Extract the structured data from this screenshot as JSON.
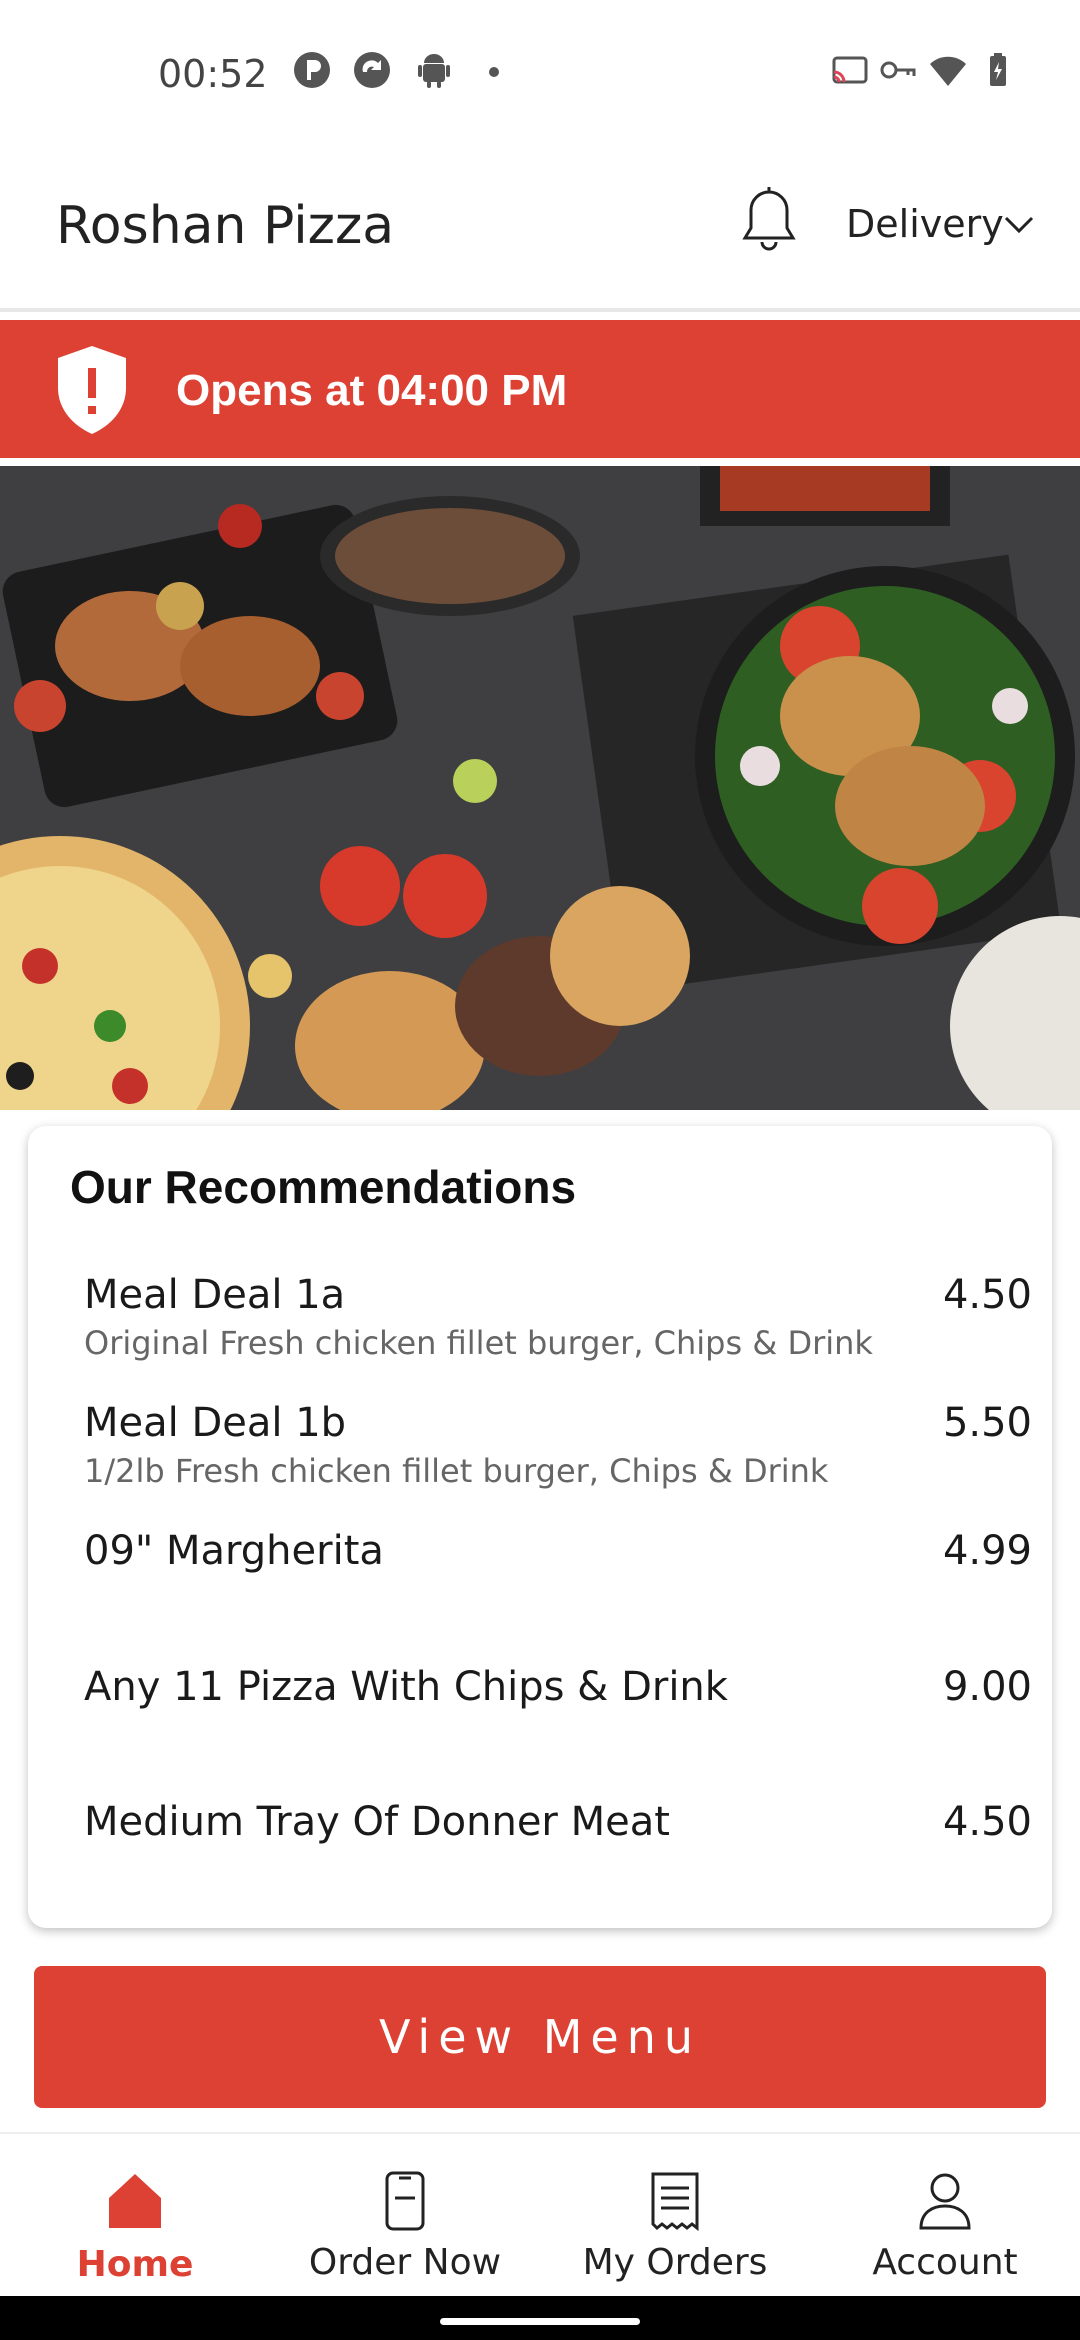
{
  "status_bar": {
    "time": "00:52",
    "left_icons": [
      "p-icon",
      "sync-icon",
      "android-icon",
      "dot-icon"
    ],
    "right_icons": [
      "cast-icon",
      "key-icon",
      "wifi-icon",
      "battery-icon"
    ]
  },
  "header": {
    "title": "Roshan Pizza",
    "delivery_label": "Delivery"
  },
  "banner": {
    "text": "Opens at 04:00 PM",
    "color": "#dc4133"
  },
  "hero": {
    "icon": "food-banner-image"
  },
  "recommendations": {
    "title": "Our Recommendations",
    "items": [
      {
        "name": "Meal Deal 1a",
        "description": "Original Fresh chicken fillet burger, Chips & Drink",
        "price": "4.50"
      },
      {
        "name": "Meal Deal 1b",
        "description": "1/2lb Fresh chicken fillet burger,  Chips &  Drink",
        "price": "5.50"
      },
      {
        "name": "09\" Margherita",
        "description": "",
        "price": "4.99"
      },
      {
        "name": "Any 11 Pizza With Chips & Drink",
        "description": "",
        "price": "9.00"
      },
      {
        "name": "Medium Tray Of Donner Meat",
        "description": "",
        "price": "4.50"
      }
    ]
  },
  "view_menu_label": "View Menu",
  "bottom_nav": {
    "items": [
      {
        "label": "Home",
        "icon": "home-icon",
        "active": true
      },
      {
        "label": "Order Now",
        "icon": "phone-order-icon",
        "active": false
      },
      {
        "label": "My Orders",
        "icon": "receipt-icon",
        "active": false
      },
      {
        "label": "Account",
        "icon": "person-icon",
        "active": false
      }
    ]
  },
  "colors": {
    "accent": "#dc4133",
    "background": "#ffffff"
  }
}
